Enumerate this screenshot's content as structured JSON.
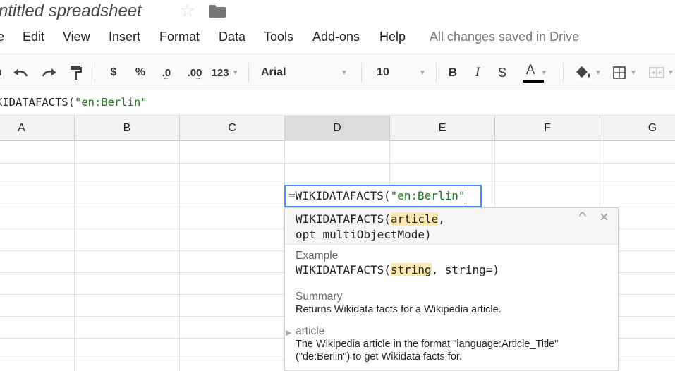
{
  "title": {
    "doc_name": "ntitled spreadsheet",
    "star_icon": "star-outline-icon",
    "folder_icon": "folder-icon"
  },
  "menu": {
    "items": [
      "e",
      "Edit",
      "View",
      "Insert",
      "Format",
      "Data",
      "Tools",
      "Add-ons",
      "Help"
    ],
    "status": "All changes saved in Drive"
  },
  "toolbar": {
    "currency": "$",
    "percent": "%",
    "decrease_decimals": ".0",
    "increase_decimals": ".00",
    "more_formats": "123",
    "font": "Arial",
    "font_size": "10",
    "bold": "B",
    "italic": "I",
    "strikethrough": "S",
    "text_color": "A",
    "text_color_value": "#000000"
  },
  "formula_bar": {
    "prefix": "KIDATAFACTS(",
    "string_arg": "\"en:Berlin\""
  },
  "grid": {
    "columns": [
      "A",
      "B",
      "C",
      "D",
      "E",
      "F",
      "G"
    ],
    "active_column": "D"
  },
  "editing_cell": {
    "prefix": "=WIKIDATAFACTS(",
    "string_arg": "\"en:Berlin\""
  },
  "help_popup": {
    "sig_name": "WIKIDATAFACTS(",
    "sig_arg1": "article",
    "sig_rest_line1": ",",
    "sig_line2": "opt_multiObjectMode)",
    "example_label": "Example",
    "example_name": "WIKIDATAFACTS(",
    "example_arg1": "string",
    "example_rest": ", string=)",
    "summary_label": "Summary",
    "summary_text": "Returns Wikidata facts for a Wikipedia article.",
    "arg_label": "article",
    "arg_text": "The Wikipedia article in the format \"language:Article_Title\" (\"de:Berlin\") to get Wikidata facts for.",
    "collapse_icon": "^",
    "close_icon": "×"
  },
  "colors": {
    "accent_blue": "#4d90fe",
    "string_green": "#1b7a1b",
    "highlight": "#fce8b2"
  }
}
